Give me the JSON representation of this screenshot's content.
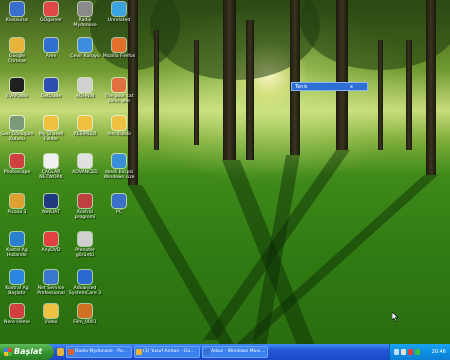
{
  "desktop": {
    "icons": [
      {
        "label": "Kiosaurus",
        "color": "#3a6fd0"
      },
      {
        "label": "GOgamer",
        "color": "#e04848"
      },
      {
        "label": "Radio Mydonose",
        "color": "#8a8a8a"
      },
      {
        "label": "Unrelated",
        "color": "#3ba3e0"
      },
      {
        "label": "Google Chrome",
        "color": "#e8b33a"
      },
      {
        "label": "Arev",
        "color": "#2f6fd0"
      },
      {
        "label": "Cevir Koruyu",
        "color": "#3c8ce0"
      },
      {
        "label": "Mozilla Firefox",
        "color": "#e0702a"
      },
      {
        "label": "EVARadio",
        "color": "#202020"
      },
      {
        "label": "GetDude",
        "color": "#2d4fb0"
      },
      {
        "label": "AOHNIN",
        "color": "#d0d0d0"
      },
      {
        "label": "The poor cat clinic one",
        "color": "#e07040"
      },
      {
        "label": "Geri Dönüşüm Kutusu",
        "color": "#7a9a7a"
      },
      {
        "label": "My Shared Folder",
        "color": "#f0c040"
      },
      {
        "label": "RESİMLER",
        "color": "#f0c040"
      },
      {
        "label": "Yeni Klasör",
        "color": "#f0c040"
      },
      {
        "label": "Photoscape",
        "color": "#d04040"
      },
      {
        "label": "ÇAĞLAR NETWORK",
        "color": "#f0f0f0"
      },
      {
        "label": "ADVANCED",
        "color": "#e0e0e0"
      },
      {
        "label": "dosdi bicipsi Windows size",
        "color": "#3a90d8"
      },
      {
        "label": "Picasa 3",
        "color": "#e0a030"
      },
      {
        "label": "NetLIAT",
        "color": "#203a80"
      },
      {
        "label": "Kostrol progromi",
        "color": "#c04040"
      },
      {
        "label": "PC",
        "color": "#3a70c8"
      },
      {
        "label": "Kostol Ag Hızlandır",
        "color": "#2a80d0"
      },
      {
        "label": "AnyDVD",
        "color": "#e04040"
      },
      {
        "label": "Prenoter görüntü",
        "color": "#d0d0d0"
      },
      {
        "label": "Kostral Ag Başlatır",
        "color": "#2a88e0"
      },
      {
        "label": "Net Service Professional",
        "color": "#3a78d0"
      },
      {
        "label": "Advanced SystemCare 3",
        "color": "#2a6ad0"
      },
      {
        "label": "Nero Home",
        "color": "#d04040"
      },
      {
        "label": "Video",
        "color": "#f0c040"
      },
      {
        "label": "Film_0001",
        "color": "#d07020"
      }
    ],
    "tooltip": {
      "text": "Tenis",
      "close": "x"
    }
  },
  "taskbar": {
    "start_label": "Başlat",
    "tasks": [
      {
        "label": "Radio Mydonose - Po...",
        "color": "#e06030"
      },
      {
        "label": "(3) Yusuf Anhan - Go...",
        "color": "#e8b33a"
      },
      {
        "label": "Adsız - Windows Movi...",
        "color": "#3a6fd0"
      }
    ],
    "clock": "20:46"
  }
}
